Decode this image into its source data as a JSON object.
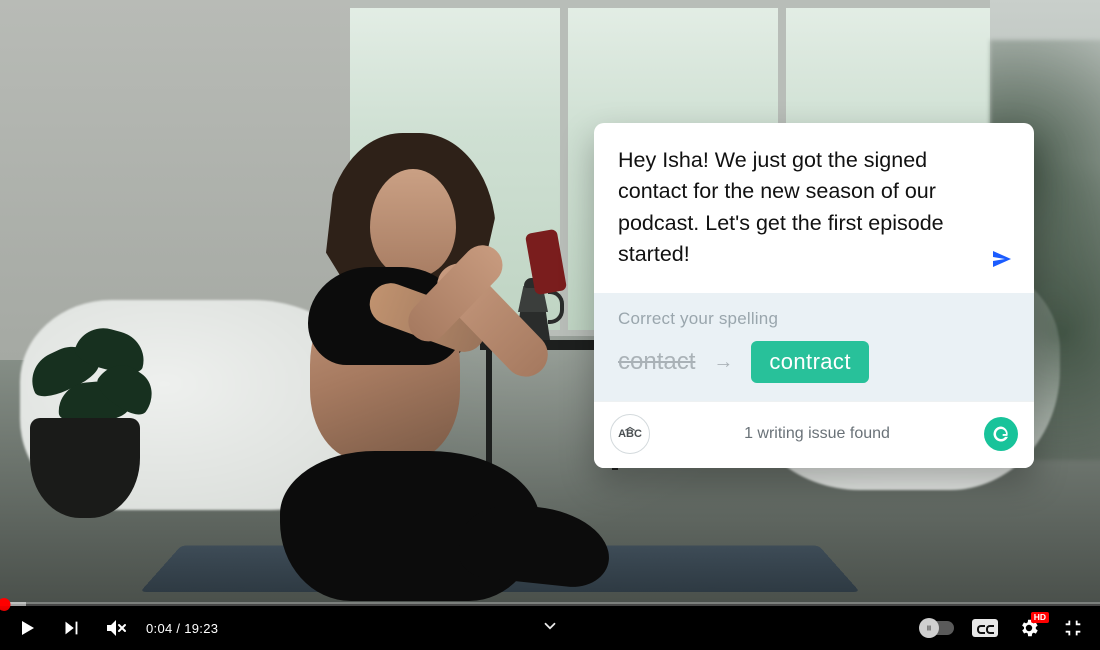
{
  "player": {
    "current_time": "0:04",
    "duration": "19:23",
    "time_display": "0:04 / 19:23",
    "progress_percent": 0.35,
    "quality_badge": "HD"
  },
  "overlay": {
    "compose_text": "Hey Isha! We just got the signed contact for the new season of our podcast. Let's get the first episode started!",
    "suggest_title": "Correct your spelling",
    "wrong_word": "contact",
    "correct_word": "contract",
    "status_text": "1 writing issue found",
    "abc_label": "ABC"
  },
  "colors": {
    "accent_green": "#18c39a",
    "pill_green": "#28c19a",
    "yt_red": "#ff0000",
    "send_blue": "#1b5cff"
  }
}
